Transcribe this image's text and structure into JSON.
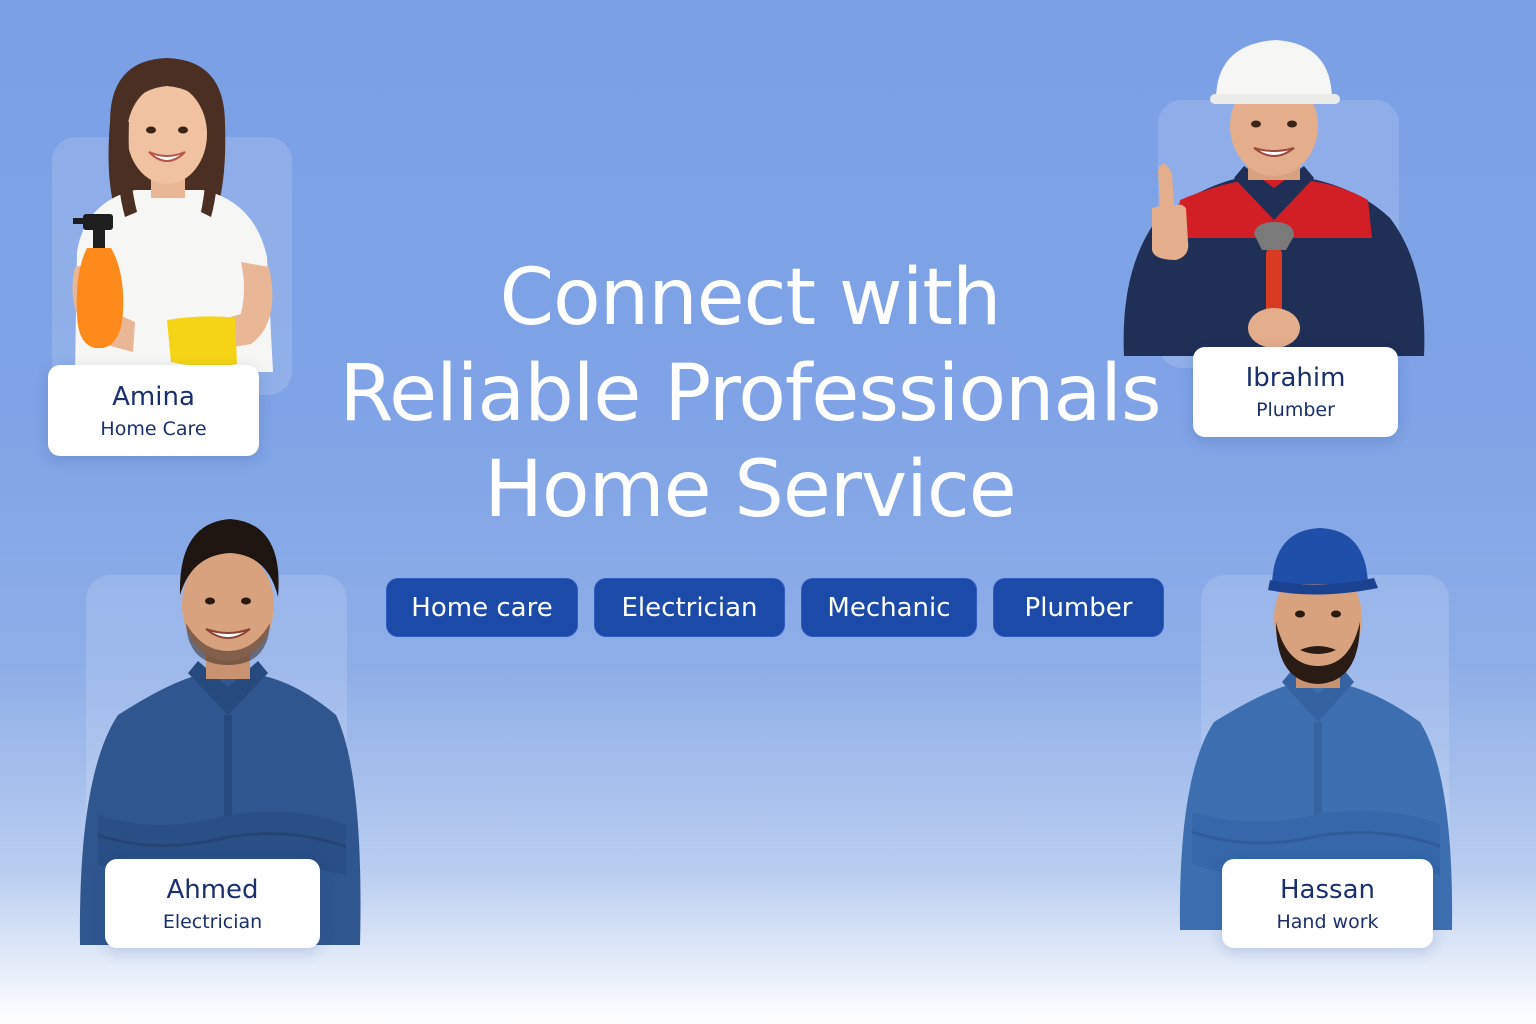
{
  "hero": {
    "line1": "Connect with",
    "line2": "Reliable Professionals",
    "line3": "Home Service"
  },
  "categories": [
    "Home care",
    "Electrician",
    "Mechanic",
    "Plumber"
  ],
  "professionals": [
    {
      "name": "Amina",
      "role": "Home Care"
    },
    {
      "name": "Ibrahim",
      "role": "Plumber"
    },
    {
      "name": "Ahmed",
      "role": "Electrician"
    },
    {
      "name": "Hassan",
      "role": "Hand work"
    }
  ],
  "colors": {
    "background_top": "#7ca0e6",
    "chip": "#1c4aa8",
    "card_text": "#1a2f6e"
  }
}
